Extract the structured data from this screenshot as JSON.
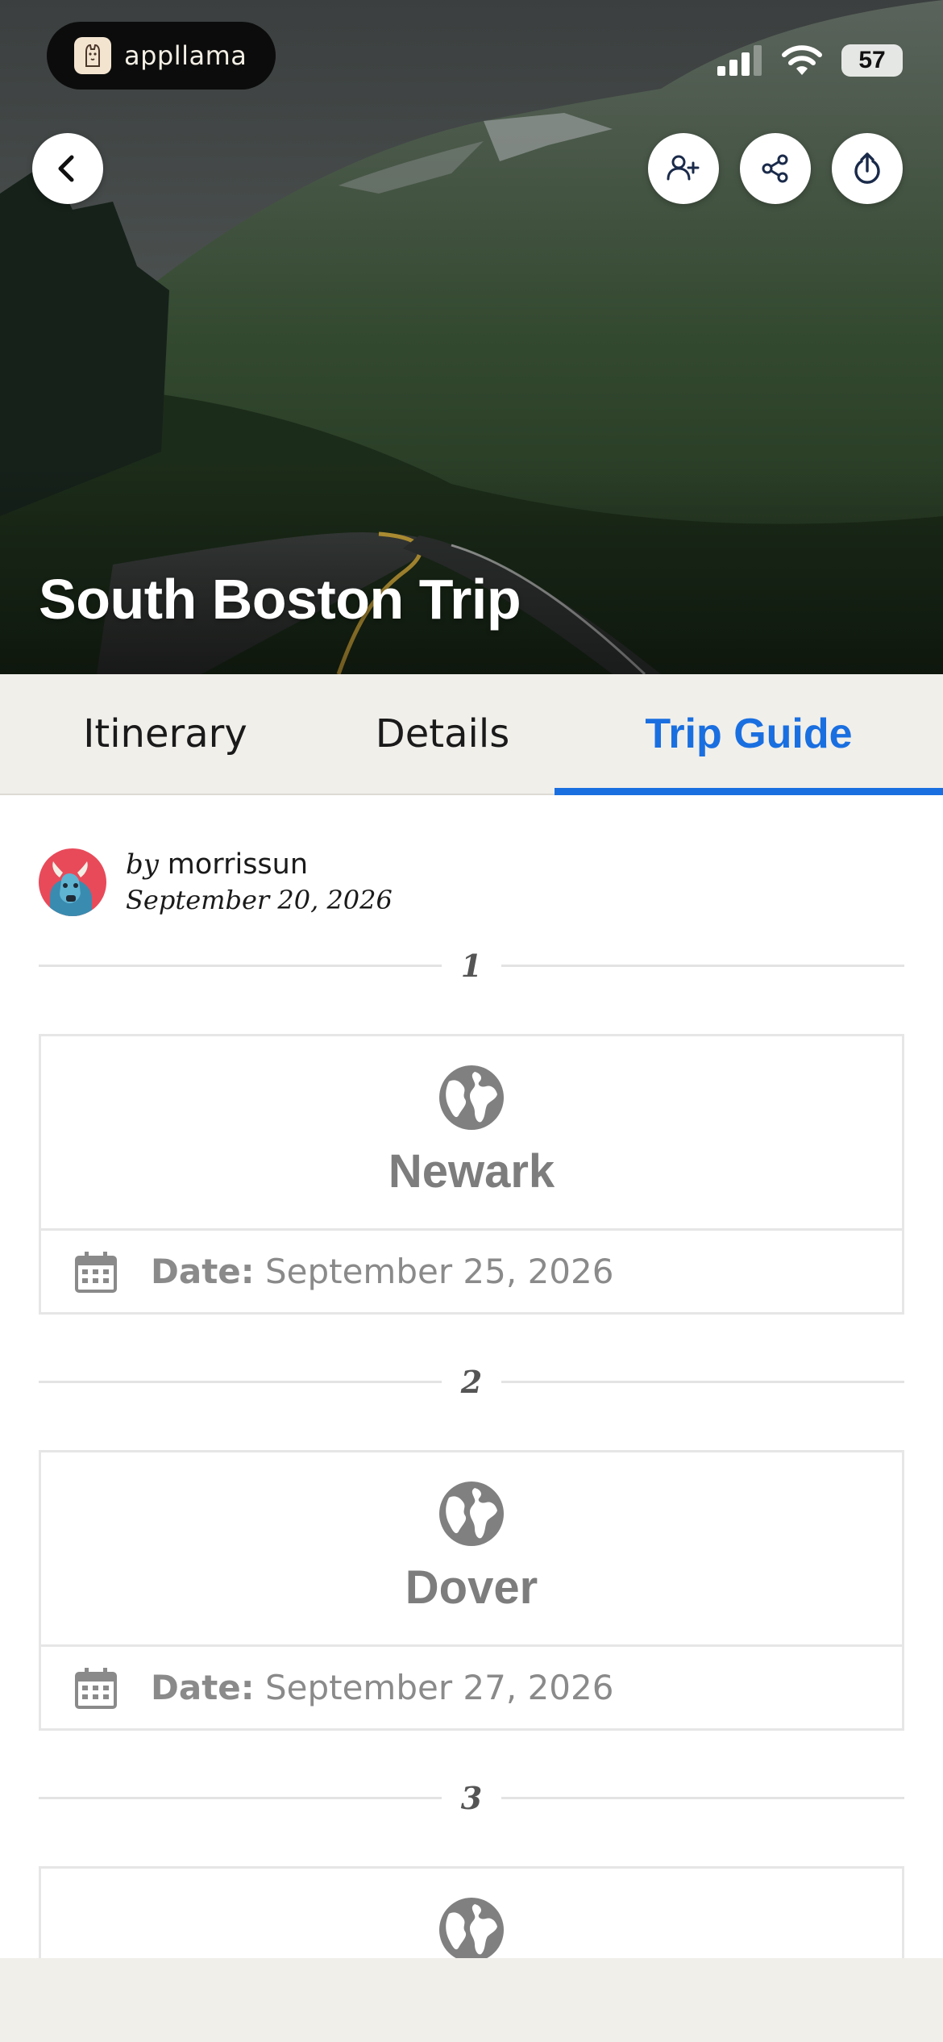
{
  "brand": {
    "name": "appllama"
  },
  "status_bar": {
    "battery": "57",
    "icons": [
      "signal-icon",
      "wifi-icon",
      "battery-icon"
    ]
  },
  "header": {
    "title": "South Boston Trip",
    "buttons": [
      "back-icon",
      "add-person-icon",
      "share-icon",
      "export-icon"
    ]
  },
  "tabs": [
    {
      "label": "Itinerary",
      "active": false
    },
    {
      "label": "Details",
      "active": false
    },
    {
      "label": "Trip Guide",
      "active": true
    }
  ],
  "author": {
    "by": "by",
    "username": "morrissun",
    "date": "September 20, 2026"
  },
  "stops": [
    {
      "number": "1",
      "city": "Newark",
      "date_label": "Date:",
      "date": "September 25, 2026"
    },
    {
      "number": "2",
      "city": "Dover",
      "date_label": "Date:",
      "date": "September 27, 2026"
    },
    {
      "number": "3"
    }
  ],
  "colors": {
    "accent": "#1a6fe0",
    "tab_bar": "#f1efea",
    "muted_text": "#7d7d7d"
  }
}
